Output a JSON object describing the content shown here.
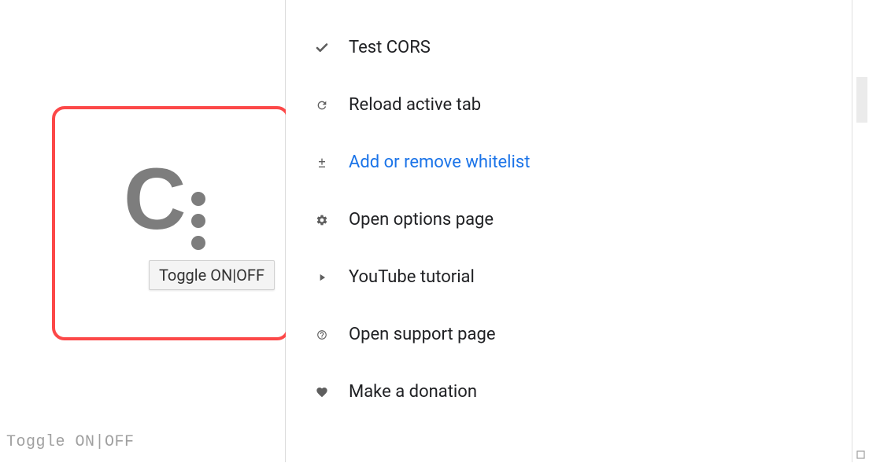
{
  "left": {
    "tooltip": "Toggle ON|OFF",
    "logo_name": "cors-unblock-logo"
  },
  "status_text": "Toggle ON|OFF",
  "menu": {
    "items": [
      {
        "icon": "check-icon",
        "label": "Test CORS",
        "link": false
      },
      {
        "icon": "reload-icon",
        "label": "Reload active tab",
        "link": false
      },
      {
        "icon": "plus-minus-icon",
        "label": "Add or remove whitelist",
        "link": true
      },
      {
        "icon": "gear-icon",
        "label": "Open options page",
        "link": false
      },
      {
        "icon": "play-icon",
        "label": "YouTube tutorial",
        "link": false
      },
      {
        "icon": "question-icon",
        "label": "Open support page",
        "link": false
      },
      {
        "icon": "heart-icon",
        "label": "Make a donation",
        "link": false
      }
    ]
  }
}
